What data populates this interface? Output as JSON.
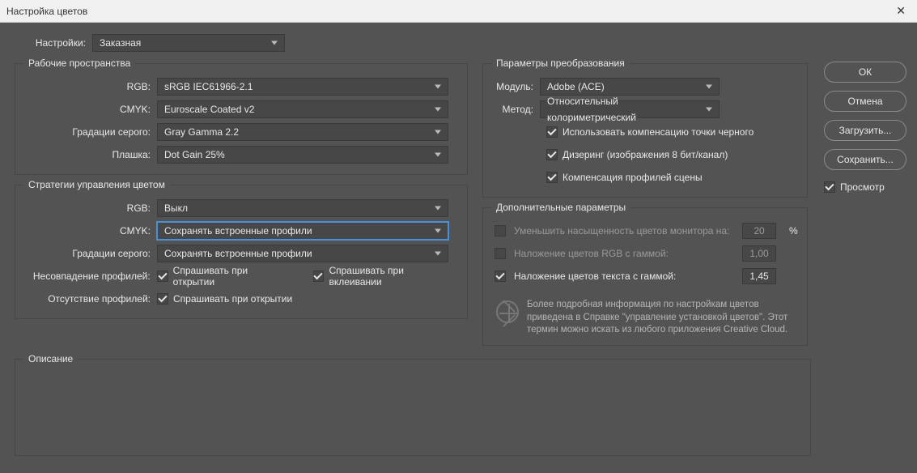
{
  "window": {
    "title": "Настройка цветов"
  },
  "settings": {
    "label": "Настройки:",
    "value": "Заказная"
  },
  "workspaces": {
    "legend": "Рабочие пространства",
    "rgb_label": "RGB:",
    "rgb_value": "sRGB IEC61966-2.1",
    "cmyk_label": "CMYK:",
    "cmyk_value": "Euroscale Coated v2",
    "gray_label": "Градации серого:",
    "gray_value": "Gray Gamma 2.2",
    "spot_label": "Плашка:",
    "spot_value": "Dot Gain 25%"
  },
  "policies": {
    "legend": "Стратегии управления цветом",
    "rgb_label": "RGB:",
    "rgb_value": "Выкл",
    "cmyk_label": "CMYK:",
    "cmyk_value": "Сохранять встроенные профили",
    "gray_label": "Градации серого:",
    "gray_value": "Сохранять встроенные профили",
    "mismatch_label": "Несовпадение профилей:",
    "ask_open": "Спрашивать при открытии",
    "ask_paste": "Спрашивать при вклеивании",
    "missing_label": "Отсутствие профилей:",
    "ask_open2": "Спрашивать при открытии"
  },
  "conversion": {
    "legend": "Параметры преобразования",
    "engine_label": "Модуль:",
    "engine_value": "Adobe (ACE)",
    "intent_label": "Метод:",
    "intent_value": "Относительный колориметрический",
    "bpc": "Использовать компенсацию точки черного",
    "dither": "Дизеринг (изображения 8 бит/канал)",
    "scene": "Компенсация профилей сцены"
  },
  "advanced": {
    "legend": "Дополнительные параметры",
    "desat": "Уменьшить насыщенность цветов монитора на:",
    "desat_value": "20",
    "pct": "%",
    "blend_rgb": "Наложение цветов RGB с гаммой:",
    "blend_rgb_value": "1,00",
    "blend_text": "Наложение цветов текста с гаммой:",
    "blend_text_value": "1,45",
    "info": "Более подробная информация по настройкам цветов приведена в Справке \"управление установкой цветов\". Этот термин можно искать из любого приложения Creative Cloud."
  },
  "description": {
    "legend": "Описание"
  },
  "buttons": {
    "ok": "ОК",
    "cancel": "Отмена",
    "load": "Загрузить...",
    "save": "Сохранить...",
    "preview": "Просмотр"
  }
}
